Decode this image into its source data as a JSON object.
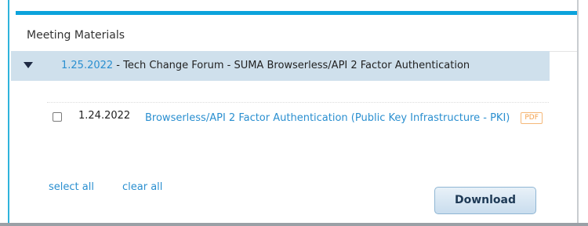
{
  "panel": {
    "title": "Meeting Materials"
  },
  "accordion": {
    "date": "1.25.2022",
    "title": " - Tech Change Forum - SUMA Browserless/API 2 Factor Authentication"
  },
  "items": [
    {
      "date": "1.24.2022",
      "link": "Browserless/API 2 Factor Authentication (Public Key Infrastructure - PKI)",
      "badge": "PDF",
      "checked": false
    }
  ],
  "actions": {
    "select_all": "select all",
    "clear_all": "clear all",
    "download": "Download"
  },
  "colors": {
    "accent_top_border": "#0ca3dc",
    "link": "#2a8fd0",
    "header_bg": "#cfe0ec",
    "pdf_badge": "#f5a04a"
  }
}
